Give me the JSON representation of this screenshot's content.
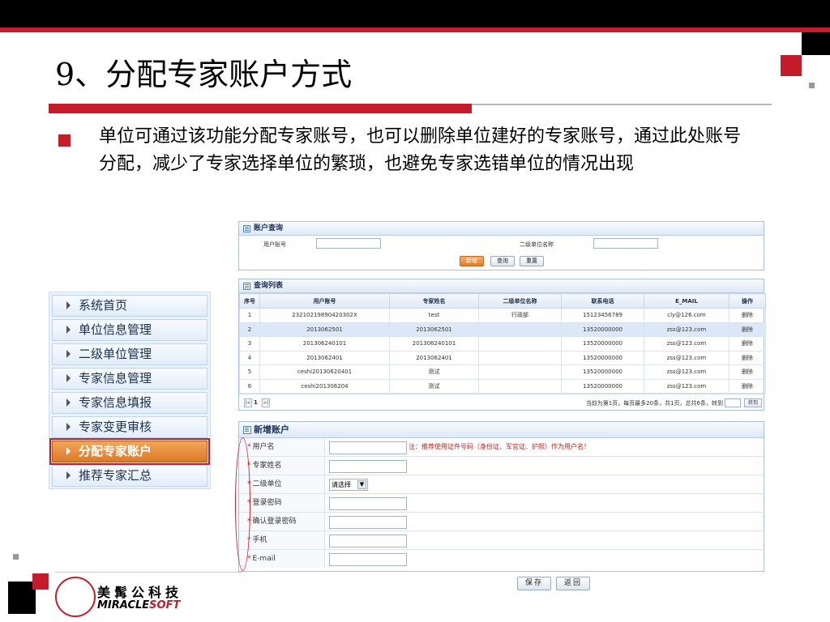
{
  "slide": {
    "title": "9、分配专家账户方式",
    "bullet": "单位可通过该功能分配专家账号，也可以删除单位建好的专家账号，通过此处账号分配，减少了专家选择单位的繁琐，也避免专家选错单位的情况出现",
    "accent_color": "#c41c2b"
  },
  "logo": {
    "cn": "美髯公科技",
    "en_main": "MIRACLE",
    "en_accent": "SOFT"
  },
  "sidebar": {
    "items": [
      {
        "label": "系统首页",
        "icon": "triangle-right-icon"
      },
      {
        "label": "单位信息管理",
        "icon": "triangle-right-icon"
      },
      {
        "label": "二级单位管理",
        "icon": "triangle-right-icon"
      },
      {
        "label": "专家信息管理",
        "icon": "triangle-right-icon"
      },
      {
        "label": "专家信息填报",
        "icon": "triangle-right-icon"
      },
      {
        "label": "专家变更审核",
        "icon": "triangle-right-icon"
      },
      {
        "label": "分配专家账户",
        "icon": "triangle-right-icon",
        "active": true
      },
      {
        "label": "推荐专家汇总",
        "icon": "triangle-right-icon"
      }
    ]
  },
  "query": {
    "title": "账户查询",
    "user_label": "用户账号",
    "unit_label": "二级单位名称",
    "buttons": {
      "add": "新增",
      "search": "查询",
      "reset": "重置"
    }
  },
  "list": {
    "title": "查询列表",
    "columns": [
      "序号",
      "用户账号",
      "专家姓名",
      "二级单位名称",
      "联系电话",
      "E_MAIL",
      "操作"
    ],
    "rows": [
      [
        "1",
        "23210219890420302X",
        "test",
        "行政部",
        "15123456789",
        "cly@126.com",
        "删除"
      ],
      [
        "2",
        "2013062501",
        "2013062501",
        "",
        "13520000000",
        "zss@123.com",
        "删除"
      ],
      [
        "3",
        "201306240101",
        "201306240101",
        "",
        "13520000000",
        "zss@123.com",
        "删除"
      ],
      [
        "4",
        "2013062401",
        "2013062401",
        "",
        "13520000000",
        "zss@123.com",
        "删除"
      ],
      [
        "5",
        "ceshi20130620401",
        "测试",
        "",
        "13520000000",
        "zss@123.com",
        "删除"
      ],
      [
        "6",
        "ceshi201306204",
        "测试",
        "",
        "13520000000",
        "zss@123.com",
        "删除"
      ]
    ],
    "pager": {
      "prev": "|<",
      "page": "1",
      "next": ">|",
      "summary": "当前为第1页，每页最多20条，共1页，总共6条，转到",
      "go": "转到"
    }
  },
  "form": {
    "title": "新增账户",
    "fields": [
      {
        "label": "用户名",
        "type": "text",
        "required": true
      },
      {
        "label": "专家姓名",
        "type": "text",
        "required": true
      },
      {
        "label": "二级单位",
        "type": "select",
        "value": "请选择",
        "required": true
      },
      {
        "label": "登录密码",
        "type": "text",
        "required": true
      },
      {
        "label": "确认登录密码",
        "type": "text",
        "required": true
      },
      {
        "label": "手机",
        "type": "text",
        "required": true
      },
      {
        "label": "E-mail",
        "type": "text",
        "required": true
      }
    ],
    "note": "注：推荐使用证件号码（身份证、军官证、护照）作为用户名！",
    "required_mark": "*",
    "save": "保存",
    "back": "返回"
  }
}
